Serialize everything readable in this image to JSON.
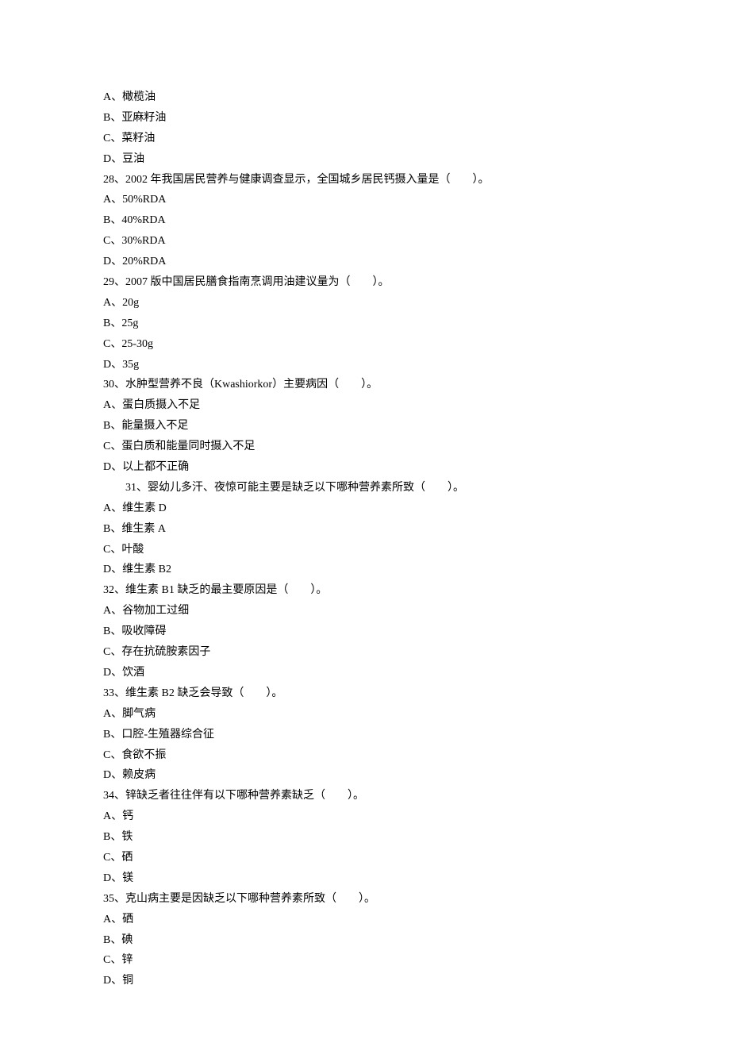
{
  "lines": [
    {
      "text": "A、橄榄油",
      "indent": false
    },
    {
      "text": "B、亚麻籽油",
      "indent": false
    },
    {
      "text": "C、菜籽油",
      "indent": false
    },
    {
      "text": "D、豆油",
      "indent": false
    },
    {
      "text": "28、2002 年我国居民营养与健康调查显示，全国城乡居民钙摄入量是（　　）。",
      "indent": false
    },
    {
      "text": "A、50%RDA",
      "indent": false
    },
    {
      "text": "B、40%RDA",
      "indent": false
    },
    {
      "text": "C、30%RDA",
      "indent": false
    },
    {
      "text": "D、20%RDA",
      "indent": false
    },
    {
      "text": "29、2007 版中国居民膳食指南烹调用油建议量为（　　）。",
      "indent": false
    },
    {
      "text": "A、20g",
      "indent": false
    },
    {
      "text": "B、25g",
      "indent": false
    },
    {
      "text": "C、25-30g",
      "indent": false
    },
    {
      "text": "D、35g",
      "indent": false
    },
    {
      "text": "30、水肿型营养不良（Kwashiorkor）主要病因（　　）。",
      "indent": false
    },
    {
      "text": "A、蛋白质摄入不足",
      "indent": false
    },
    {
      "text": "B、能量摄入不足",
      "indent": false
    },
    {
      "text": "C、蛋白质和能量同时摄入不足",
      "indent": false
    },
    {
      "text": "D、以上都不正确",
      "indent": false
    },
    {
      "text": "31、婴幼儿多汗、夜惊可能主要是缺乏以下哪种营养素所致（　　）。",
      "indent": true
    },
    {
      "text": "A、维生素 D",
      "indent": false
    },
    {
      "text": "B、维生素 A",
      "indent": false
    },
    {
      "text": "C、叶酸",
      "indent": false
    },
    {
      "text": "D、维生素 B2",
      "indent": false
    },
    {
      "text": "32、维生素 B1 缺乏的最主要原因是（　　）。",
      "indent": false
    },
    {
      "text": "A、谷物加工过细",
      "indent": false
    },
    {
      "text": "B、吸收障碍",
      "indent": false
    },
    {
      "text": "C、存在抗硫胺素因子",
      "indent": false
    },
    {
      "text": "D、饮酒",
      "indent": false
    },
    {
      "text": "33、维生素 B2 缺乏会导致（　　）。",
      "indent": false
    },
    {
      "text": "A、脚气病",
      "indent": false
    },
    {
      "text": "B、口腔-生殖器综合征",
      "indent": false
    },
    {
      "text": "C、食欲不振",
      "indent": false
    },
    {
      "text": "D、赖皮病",
      "indent": false
    },
    {
      "text": "34、锌缺乏者往往伴有以下哪种营养素缺乏（　　）。",
      "indent": false
    },
    {
      "text": "A、钙",
      "indent": false
    },
    {
      "text": "B、铁",
      "indent": false
    },
    {
      "text": "C、硒",
      "indent": false
    },
    {
      "text": "D、镁",
      "indent": false
    },
    {
      "text": "35、克山病主要是因缺乏以下哪种营养素所致（　　）。",
      "indent": false
    },
    {
      "text": "A、硒",
      "indent": false
    },
    {
      "text": "B、碘",
      "indent": false
    },
    {
      "text": "C、锌",
      "indent": false
    },
    {
      "text": "D、铜",
      "indent": false
    }
  ]
}
